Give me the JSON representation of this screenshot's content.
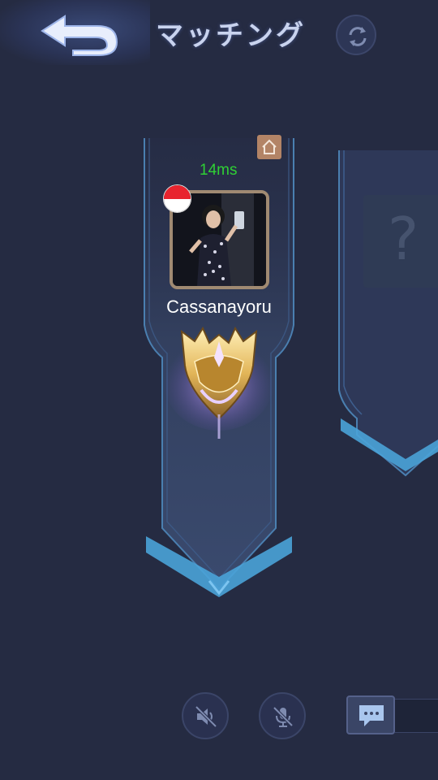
{
  "header": {
    "title": "マッチング",
    "back_icon": "back-arrow-icon",
    "refresh_icon": "refresh-icon"
  },
  "player": {
    "ping": "14ms",
    "name": "Cassanayoru",
    "home_icon": "home-icon",
    "flag": "indonesia-flag-icon",
    "rank_icon": "gold-rank-emblem-icon"
  },
  "next_slot": {
    "placeholder": "?"
  },
  "bottom_bar": {
    "speaker_icon": "speaker-muted-icon",
    "mic_icon": "mic-muted-icon",
    "chat_icon": "chat-icon"
  },
  "colors": {
    "background": "#252b42",
    "ping": "#2fd034",
    "panel_accent": "#4aa3d8",
    "title": "#c9d3ee"
  }
}
